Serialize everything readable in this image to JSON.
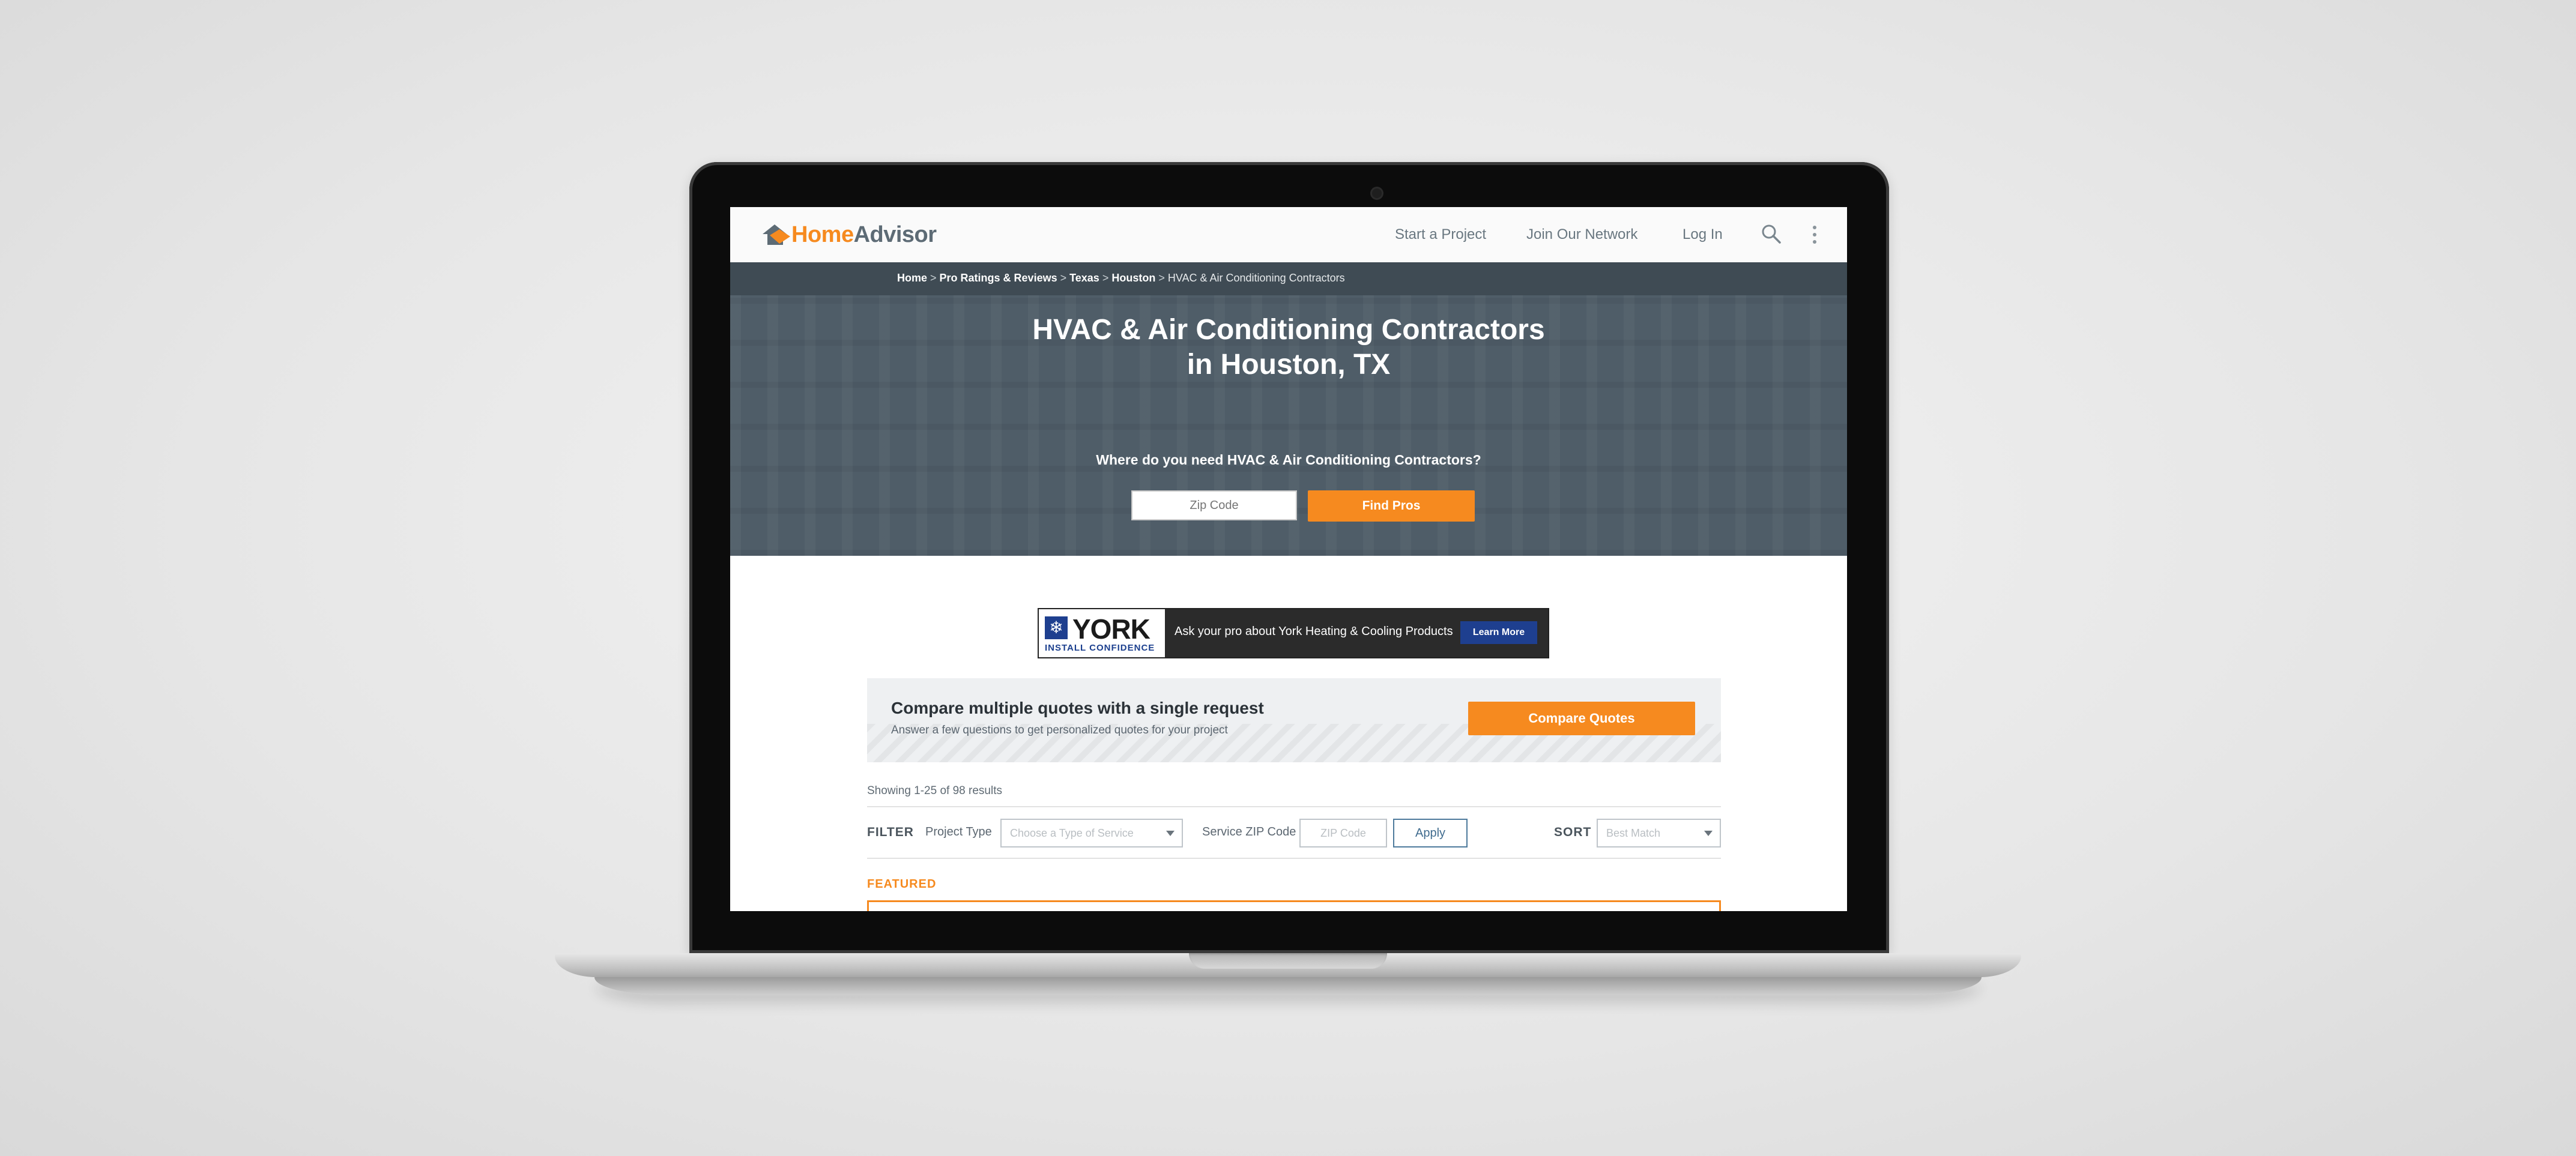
{
  "header": {
    "logo_home": "Home",
    "logo_advisor": "Advisor",
    "nav": [
      "Start a Project",
      "Join Our Network",
      "Log In"
    ],
    "search_icon": "search-icon",
    "more_icon": "more-vertical-icon"
  },
  "breadcrumb": {
    "items": [
      "Home",
      "Pro Ratings & Reviews",
      "Texas",
      "Houston"
    ],
    "current": "HVAC & Air Conditioning Contractors",
    "separator": ">"
  },
  "hero": {
    "title_line1": "HVAC & Air Conditioning Contractors",
    "title_line2": "in Houston, TX",
    "subtitle": "Where do you need HVAC & Air Conditioning Contractors?",
    "zip_placeholder": "Zip Code",
    "button": "Find Pros"
  },
  "ad": {
    "brand": "YORK",
    "tagline": "INSTALL CONFIDENCE",
    "text": "Ask your pro about York Heating & Cooling Products",
    "button": "Learn More"
  },
  "compare": {
    "title": "Compare multiple quotes with a single request",
    "subtitle": "Answer a few questions to get personalized quotes for your project",
    "button": "Compare Quotes"
  },
  "results": {
    "showing": "Showing 1-25 of 98 results"
  },
  "filter": {
    "label": "FILTER",
    "project_type_label": "Project Type",
    "project_type_placeholder": "Choose a Type of Service",
    "zip_label": "Service ZIP Code",
    "zip_placeholder": "ZIP Code",
    "apply": "Apply",
    "sort_label": "SORT",
    "sort_value": "Best Match"
  },
  "featured_label": "FEATURED",
  "colors": {
    "brand_orange": "#f68a1f",
    "hero_bg": "#4f5d68",
    "breadcrumb_bg": "#3f4b54",
    "text_dark": "#2b3238"
  }
}
